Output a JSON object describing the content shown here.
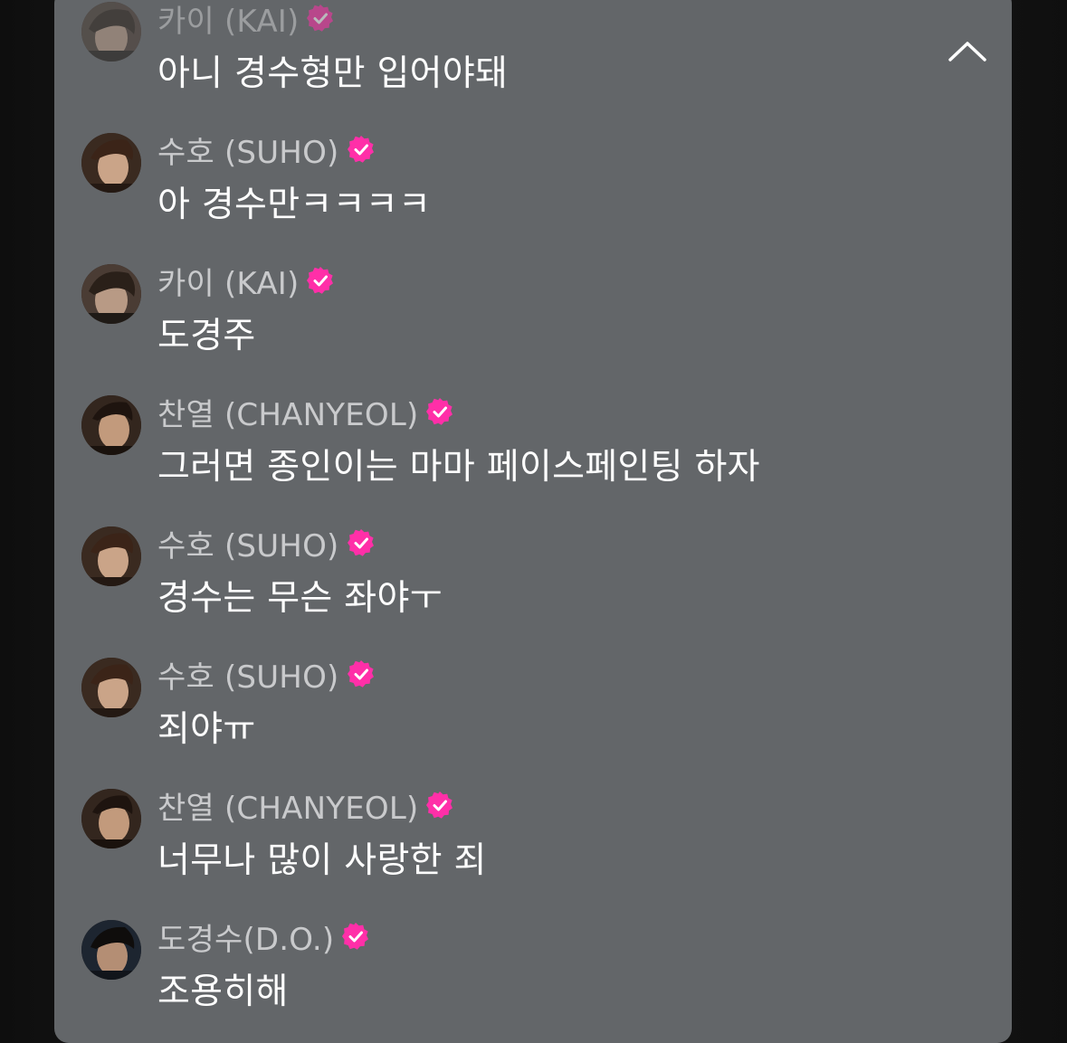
{
  "colors": {
    "panel": "#636669",
    "username": "#c9cacc",
    "text": "#ffffff",
    "verified": "#ff2fa8"
  },
  "panel": {
    "collapse_icon": "chevron-up-icon"
  },
  "messages": [
    {
      "username": "카이 (KAI)",
      "text": "아니 경수형만 입어야돼",
      "avatar": "kai"
    },
    {
      "username": "수호 (SUHO)",
      "text": "아 경수만ㅋㅋㅋㅋ",
      "avatar": "suho"
    },
    {
      "username": "카이 (KAI)",
      "text": "도경주",
      "avatar": "kai"
    },
    {
      "username": "찬열 (CHANYEOL)",
      "text": "그러면 종인이는 마마 페이스페인팅 하자",
      "avatar": "chanyeol"
    },
    {
      "username": "수호 (SUHO)",
      "text": "경수는 무슨 좌야ㅜ",
      "avatar": "suho"
    },
    {
      "username": "수호 (SUHO)",
      "text": "죄야ㅠ",
      "avatar": "suho"
    },
    {
      "username": "찬열 (CHANYEOL)",
      "text": "너무나 많이 사랑한 죄",
      "avatar": "chanyeol"
    },
    {
      "username": "도경수(D.O.)",
      "text": "조용히해",
      "avatar": "do"
    }
  ]
}
